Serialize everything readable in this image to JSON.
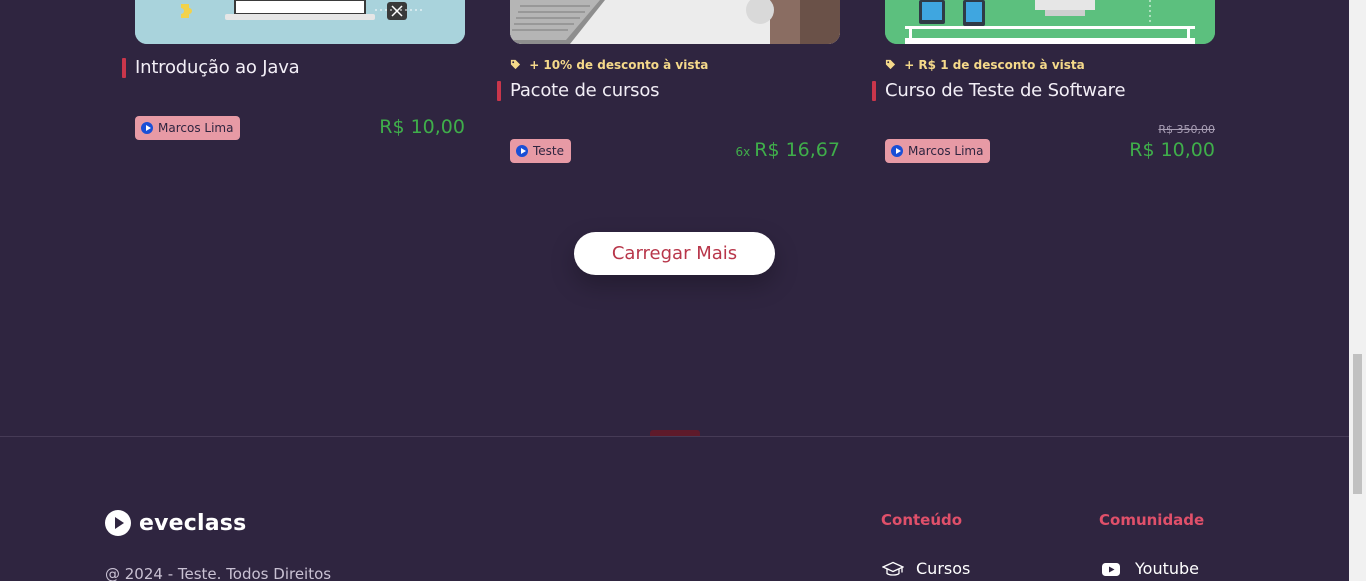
{
  "courses": [
    {
      "title": "Introdução ao Java",
      "discount": "",
      "author": "Marcos Lima",
      "installments": "",
      "price": "R$ 10,00",
      "old_price": ""
    },
    {
      "title": "Pacote de cursos",
      "discount": "+ 10% de desconto à vista",
      "author": "Teste",
      "installments": "6x",
      "price": "R$ 16,67",
      "old_price": ""
    },
    {
      "title": "Curso de Teste de Software",
      "discount": "+ R$ 1 de desconto à vista",
      "author": "Marcos Lima",
      "installments": "",
      "price": "R$ 10,00",
      "old_price": "R$ 350,00"
    }
  ],
  "load_more_label": "Carregar Mais",
  "footer": {
    "brand": "eveclass",
    "copyright": "@ 2024 - Teste. Todos Direitos",
    "columns": [
      {
        "heading": "Conteúdo",
        "link": "Cursos",
        "icon": "graduation-cap-icon"
      },
      {
        "heading": "Comunidade",
        "link": "Youtube",
        "icon": "youtube-icon"
      }
    ]
  },
  "colors": {
    "background": "#2f2540",
    "accent": "#c9364b",
    "price": "#3fae4a",
    "discount": "#f5d98a",
    "author_badge": "#e79aa5",
    "footer_heading": "#e0506a"
  }
}
